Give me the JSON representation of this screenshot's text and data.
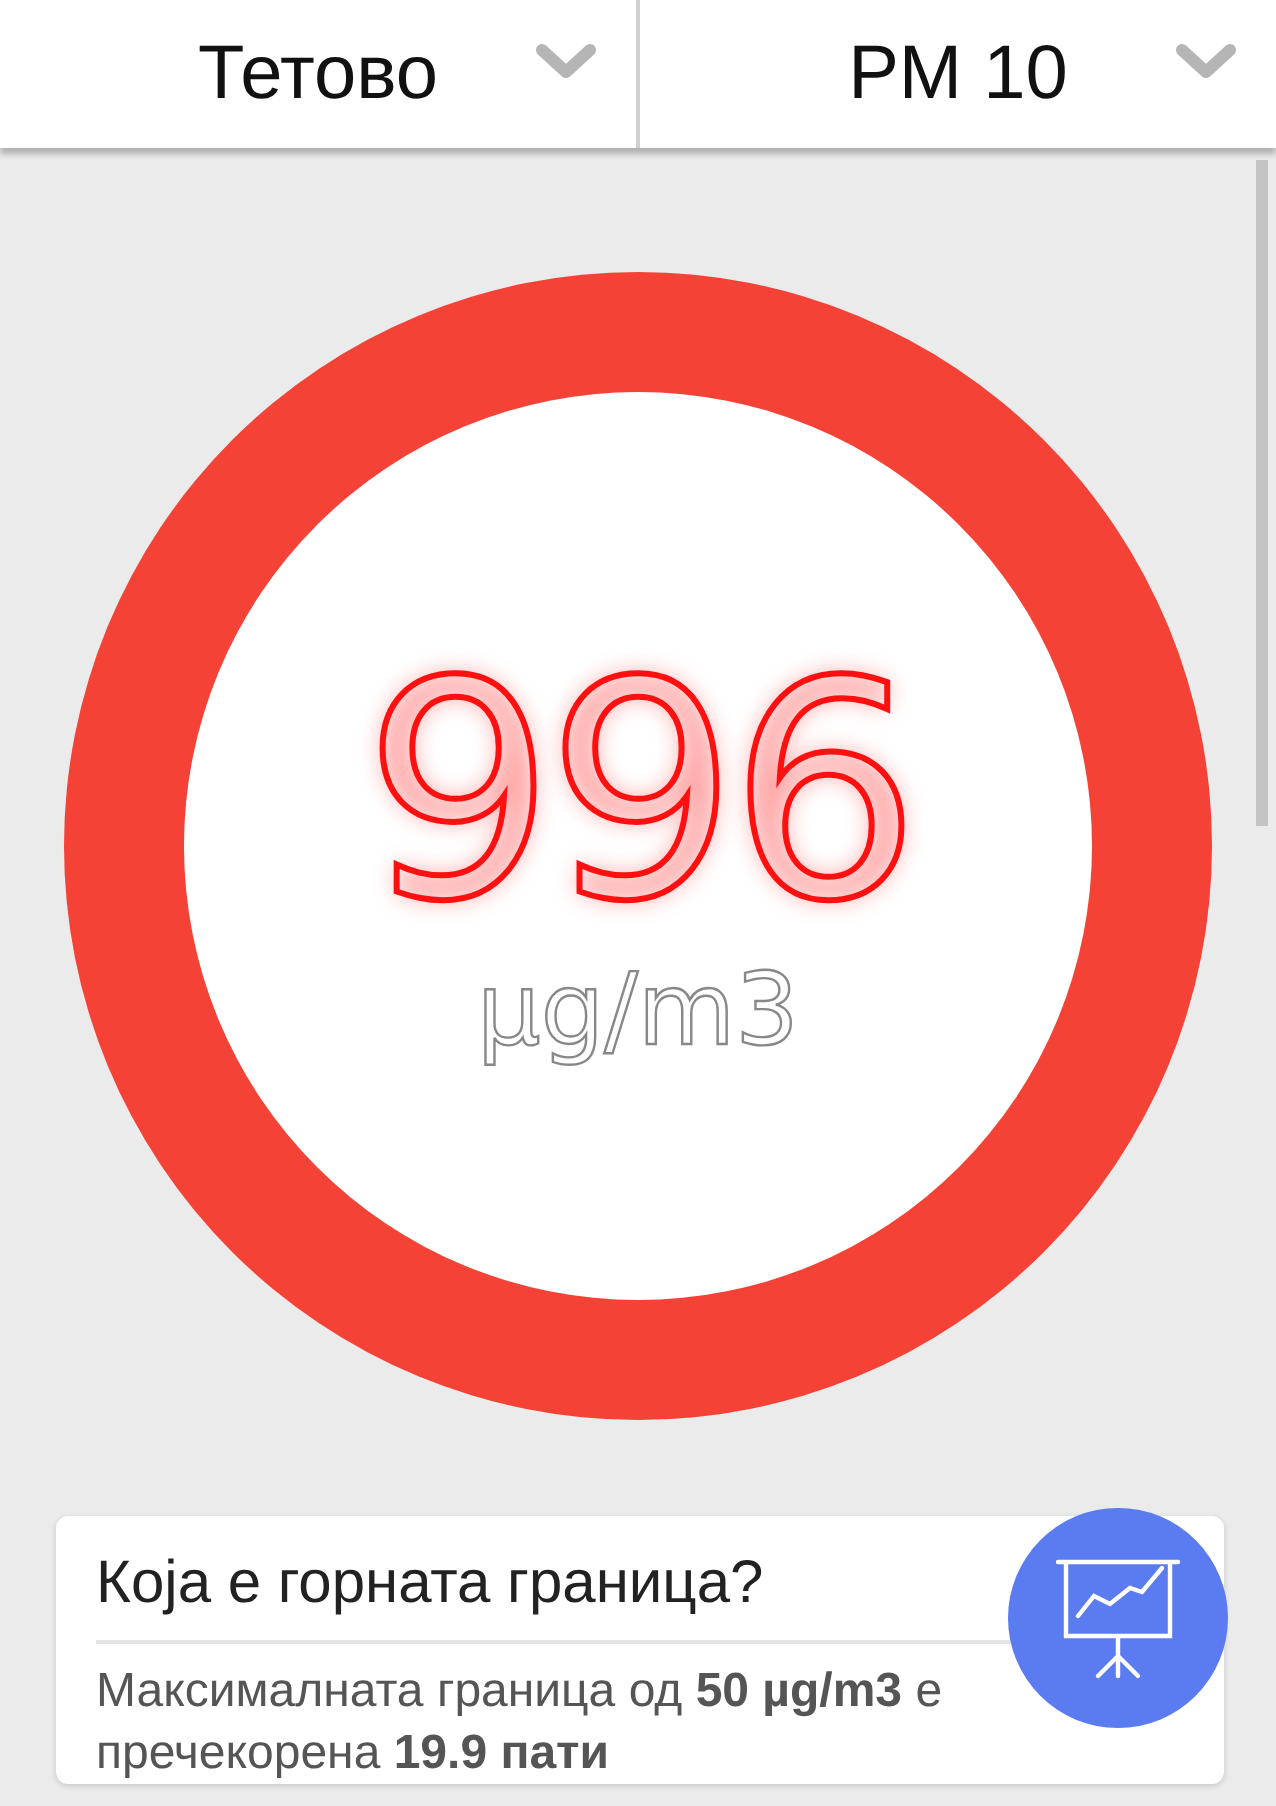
{
  "selectors": [
    {
      "label": "Тетово"
    },
    {
      "label": "PM 10"
    }
  ],
  "reading": {
    "value": "996",
    "unit": "µg/m3"
  },
  "info_card": {
    "title": "Која е горната граница?",
    "text": "Максималната граница од **50 µg/m3** е пречекорена **19.9 пати**"
  }
}
